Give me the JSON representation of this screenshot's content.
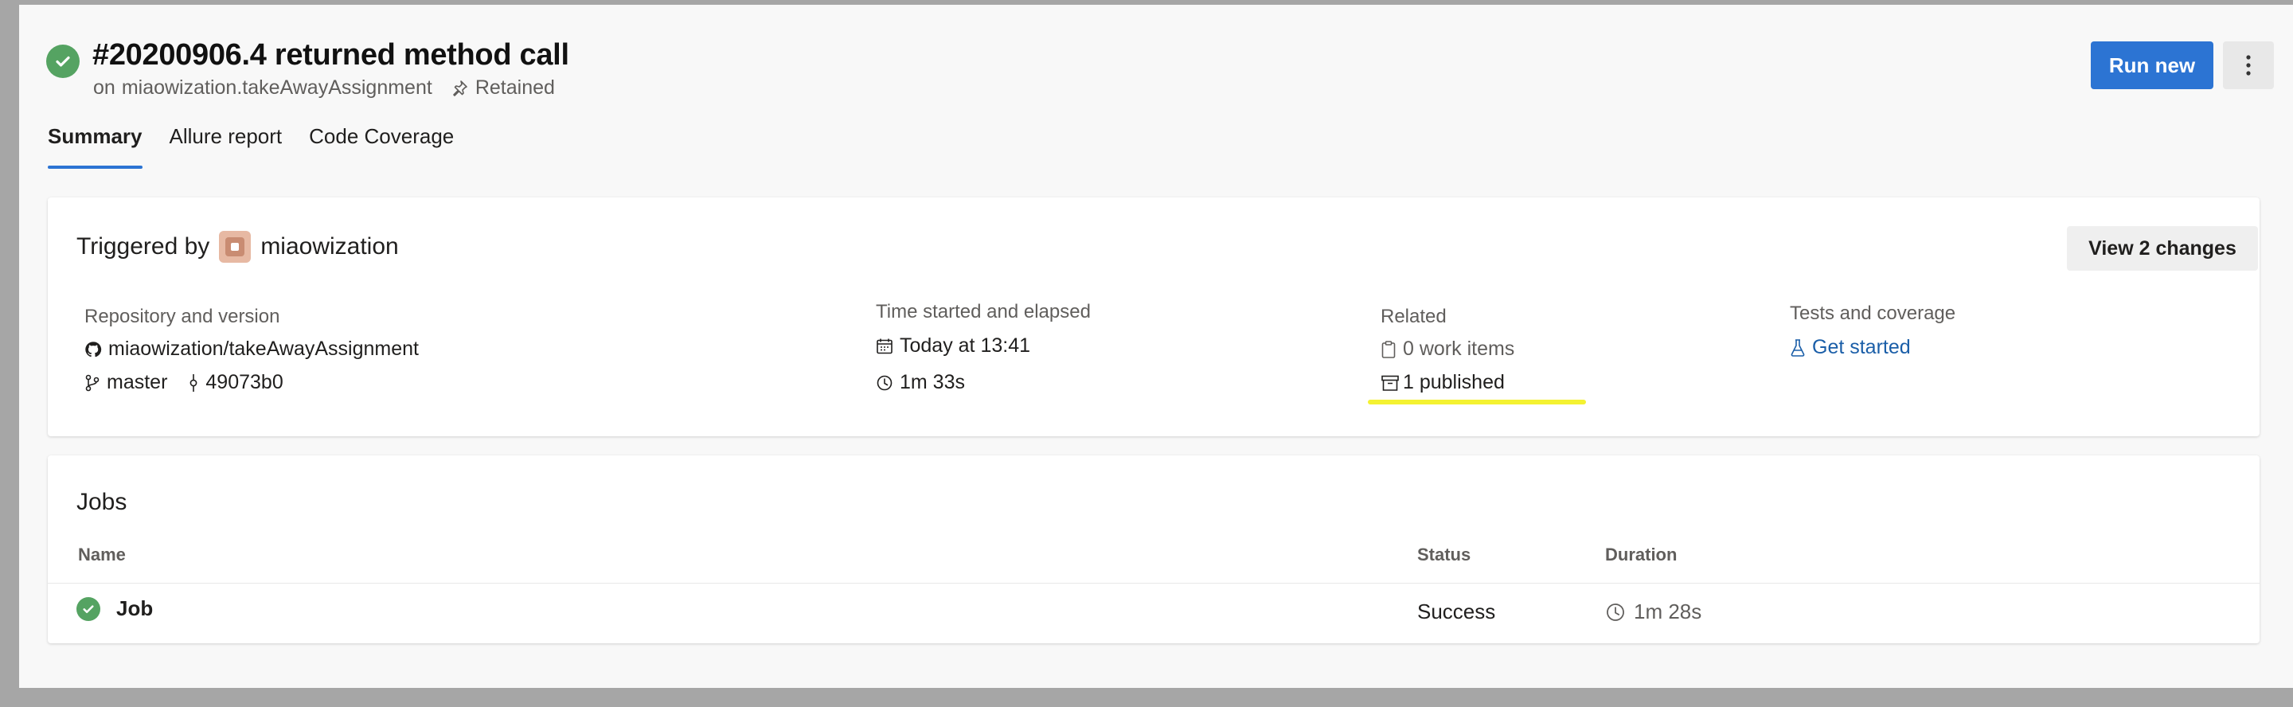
{
  "header": {
    "title": "#20200906.4 returned method call",
    "subtitle_prefix": "on",
    "pipeline": "miaowization.takeAwayAssignment",
    "retained_label": "Retained",
    "status_icon": "success-check-icon",
    "run_new_label": "Run new",
    "more_icon": "more-vertical-icon"
  },
  "tabs": [
    {
      "label": "Summary",
      "active": true
    },
    {
      "label": "Allure report",
      "active": false
    },
    {
      "label": "Code Coverage",
      "active": false
    }
  ],
  "summary": {
    "triggered_prefix": "Triggered by",
    "triggered_user": "miaowization",
    "view_changes_label": "View 2 changes",
    "repository": {
      "label": "Repository and version",
      "repo": "miaowization/takeAwayAssignment",
      "branch": "master",
      "commit": "49073b0"
    },
    "time": {
      "label": "Time started and elapsed",
      "started": "Today at 13:41",
      "elapsed": "1m 33s"
    },
    "related": {
      "label": "Related",
      "work_items": "0 work items",
      "published": "1 published"
    },
    "tests": {
      "label": "Tests and coverage",
      "link": "Get started"
    }
  },
  "jobs": {
    "title": "Jobs",
    "columns": [
      "Name",
      "Status",
      "Duration"
    ],
    "rows": [
      {
        "name": "Job",
        "status": "Success",
        "duration": "1m 28s"
      }
    ]
  },
  "colors": {
    "accent": "#2c74d3",
    "success": "#55a362",
    "highlight": "#f4f232",
    "link": "#1a5ea8"
  }
}
